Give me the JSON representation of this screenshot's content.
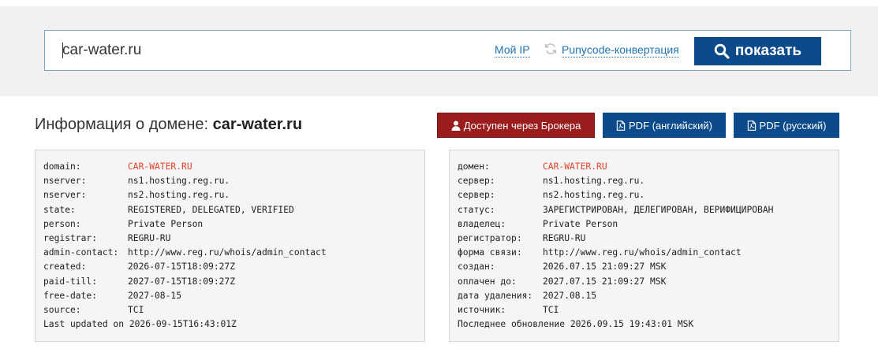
{
  "search": {
    "value": "car-water.ru",
    "my_ip": "Мой IP",
    "punycode": "Punycode-конвертация",
    "show_button": "показать"
  },
  "title": {
    "prefix": "Информация о домене: ",
    "domain": "car-water.ru"
  },
  "buttons": {
    "broker": "Доступен через Брокера",
    "pdf_en": "PDF (английский)",
    "pdf_ru": "PDF (русский)"
  },
  "whois_en": [
    {
      "key": "domain:",
      "value": "CAR-WATER.RU"
    },
    {
      "key": "nserver:",
      "value": "ns1.hosting.reg.ru."
    },
    {
      "key": "nserver:",
      "value": "ns2.hosting.reg.ru."
    },
    {
      "key": "state:",
      "value": "REGISTERED, DELEGATED, VERIFIED"
    },
    {
      "key": "person:",
      "value": "Private Person"
    },
    {
      "key": "registrar:",
      "value": "REGRU-RU"
    },
    {
      "key": "admin-contact:",
      "value": "http://www.reg.ru/whois/admin_contact"
    },
    {
      "key": "created:",
      "value": "2026-07-15T18:09:27Z"
    },
    {
      "key": "paid-till:",
      "value": "2027-07-15T18:09:27Z"
    },
    {
      "key": "free-date:",
      "value": "2027-08-15"
    },
    {
      "key": "source:",
      "value": "TCI"
    }
  ],
  "whois_en_footer": "Last updated on 2026-09-15T16:43:01Z",
  "whois_ru": [
    {
      "key": "домен:",
      "value": "CAR-WATER.RU"
    },
    {
      "key": "сервер:",
      "value": "ns1.hosting.reg.ru."
    },
    {
      "key": "сервер:",
      "value": "ns2.hosting.reg.ru."
    },
    {
      "key": "статус:",
      "value": "ЗАРЕГИСТРИРОВАН, ДЕЛЕГИРОВАН, ВЕРИФИЦИРОВАН"
    },
    {
      "key": "владелец:",
      "value": "Private Person"
    },
    {
      "key": "регистратор:",
      "value": "REGRU-RU"
    },
    {
      "key": "форма связи:",
      "value": "http://www.reg.ru/whois/admin_contact"
    },
    {
      "key": "создан:",
      "value": "2026.07.15 21:09:27 MSK"
    },
    {
      "key": "оплачен до:",
      "value": "2027.07.15 21:09:27 MSK"
    },
    {
      "key": "дата удаления:",
      "value": "2027.08.15"
    },
    {
      "key": "источник:",
      "value": "TCI"
    }
  ],
  "whois_ru_footer": "Последнее обновление 2026.09.15 19:43:01 MSK",
  "colors": {
    "primary_button": "#0b4a8b",
    "broker_button": "#9b1c1c",
    "domain_highlight": "#e0452a",
    "link": "#1e73b4"
  }
}
